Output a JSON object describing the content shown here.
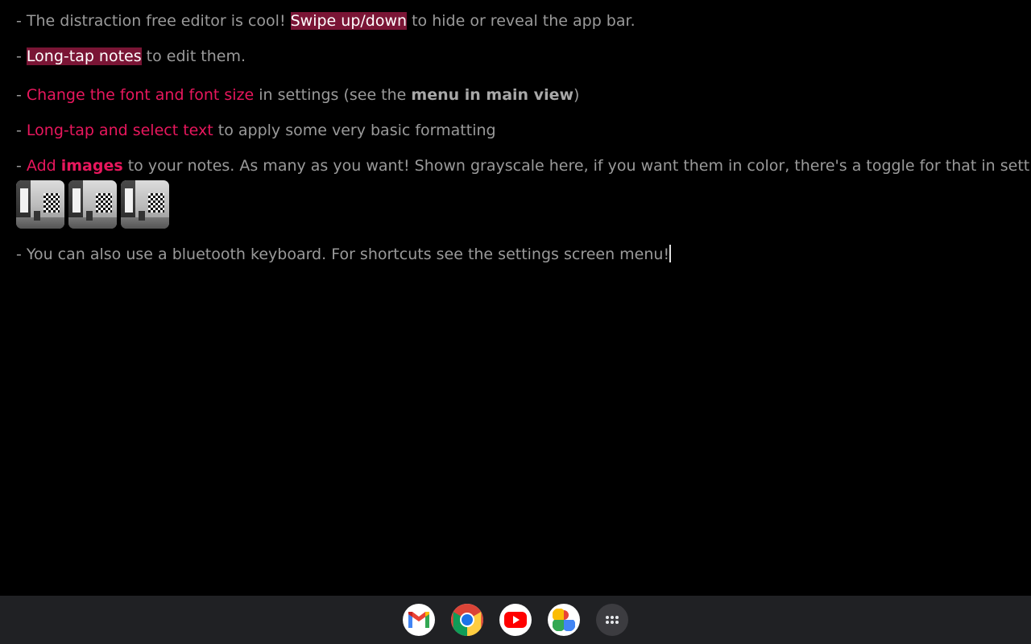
{
  "editor": {
    "line1": {
      "prefix": "- The distraction free editor is cool! ",
      "highlight": "Swipe up/down",
      "suffix": " to hide or reveal the app bar."
    },
    "line2": {
      "prefix": "- ",
      "highlight": "Long-tap notes",
      "suffix": " to edit them."
    },
    "line3": {
      "prefix": "- ",
      "accent": "Change the font and font size",
      "middle": " in settings (see the ",
      "bold": "menu in main view",
      "suffix": ")"
    },
    "line4": {
      "prefix": "- ",
      "accent": "Long-tap and select text",
      "suffix": " to apply some very basic formatting"
    },
    "line5": {
      "prefix": "- ",
      "accent": "Add ",
      "accent_bold": "images",
      "suffix": " to your notes. As many as you want! Shown grayscale here, if you want them in color, there's a toggle for that in settings"
    },
    "line6": {
      "text": "- You can also use a bluetooth keyboard. For shortcuts see the settings screen menu!"
    }
  },
  "colors": {
    "background": "#000000",
    "text": "#9a9a9a",
    "accent": "#e8175d",
    "highlight_bg": "#7a1535",
    "shelf_bg": "#202124"
  },
  "shelf": {
    "apps": [
      {
        "icon": "gmail-icon"
      },
      {
        "icon": "chrome-icon"
      },
      {
        "icon": "youtube-icon"
      },
      {
        "icon": "photos-icon"
      },
      {
        "icon": "launcher-icon"
      }
    ]
  }
}
